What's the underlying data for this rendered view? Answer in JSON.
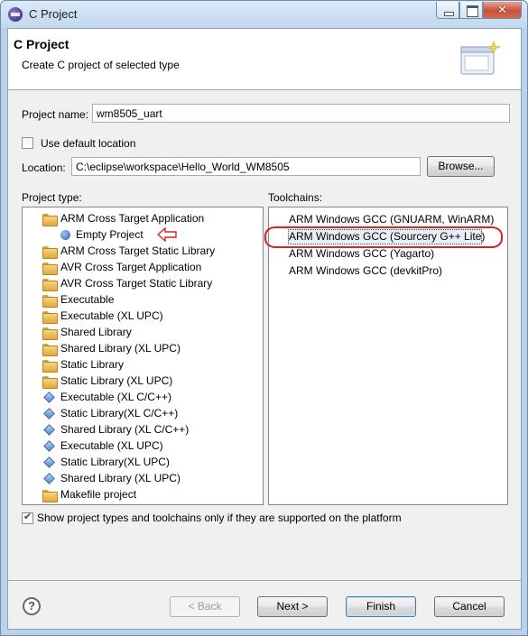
{
  "window": {
    "title": "C Project",
    "close_glyph": "✕"
  },
  "header": {
    "title": "C Project",
    "description": "Create C project of selected type"
  },
  "project_name": {
    "label": "Project name:",
    "value": "wm8505_uart"
  },
  "use_default_location": {
    "label": "Use default location",
    "checked": false
  },
  "location": {
    "label": "Location:",
    "value": "C:\\eclipse\\workspace\\Hello_World_WM8505",
    "browse_label": "Browse..."
  },
  "project_type": {
    "label": "Project type:",
    "items": [
      {
        "label": "ARM Cross Target Application",
        "icon": "folder-icon"
      },
      {
        "label": "Empty Project",
        "icon": "project-ball-icon"
      },
      {
        "label": "ARM Cross Target Static Library",
        "icon": "folder-icon"
      },
      {
        "label": "AVR Cross Target Application",
        "icon": "folder-icon"
      },
      {
        "label": "AVR Cross Target Static Library",
        "icon": "folder-icon"
      },
      {
        "label": "Executable",
        "icon": "folder-icon"
      },
      {
        "label": "Executable (XL UPC)",
        "icon": "folder-icon"
      },
      {
        "label": "Shared Library",
        "icon": "folder-icon"
      },
      {
        "label": "Shared Library (XL UPC)",
        "icon": "folder-icon"
      },
      {
        "label": "Static Library",
        "icon": "folder-icon"
      },
      {
        "label": "Static Library (XL UPC)",
        "icon": "folder-icon"
      },
      {
        "label": "Executable (XL C/C++)",
        "icon": "diamond-icon"
      },
      {
        "label": "Static Library(XL C/C++)",
        "icon": "diamond-icon"
      },
      {
        "label": "Shared Library (XL C/C++)",
        "icon": "diamond-icon"
      },
      {
        "label": "Executable (XL UPC)",
        "icon": "diamond-icon"
      },
      {
        "label": "Static Library(XL UPC)",
        "icon": "diamond-icon"
      },
      {
        "label": "Shared Library (XL UPC)",
        "icon": "diamond-icon"
      },
      {
        "label": "Makefile project",
        "icon": "folder-icon"
      }
    ]
  },
  "toolchains": {
    "label": "Toolchains:",
    "items": [
      "ARM Windows GCC (GNUARM, WinARM)",
      "ARM Windows GCC (Sourcery G++ Lite)",
      "ARM Windows GCC (Yagarto)",
      "ARM Windows GCC (devkitPro)"
    ],
    "selected": "ARM Windows GCC (Sourcery G++ Lite)"
  },
  "show_supported": {
    "label": "Show project types and toolchains only if they are supported on the platform",
    "checked": true
  },
  "footer": {
    "help_glyph": "?",
    "back_label": "< Back",
    "next_label": "Next >",
    "finish_label": "Finish",
    "cancel_label": "Cancel"
  },
  "colors": {
    "annotation_red": "#d8232a",
    "title_bar": "#c2d7ee"
  }
}
